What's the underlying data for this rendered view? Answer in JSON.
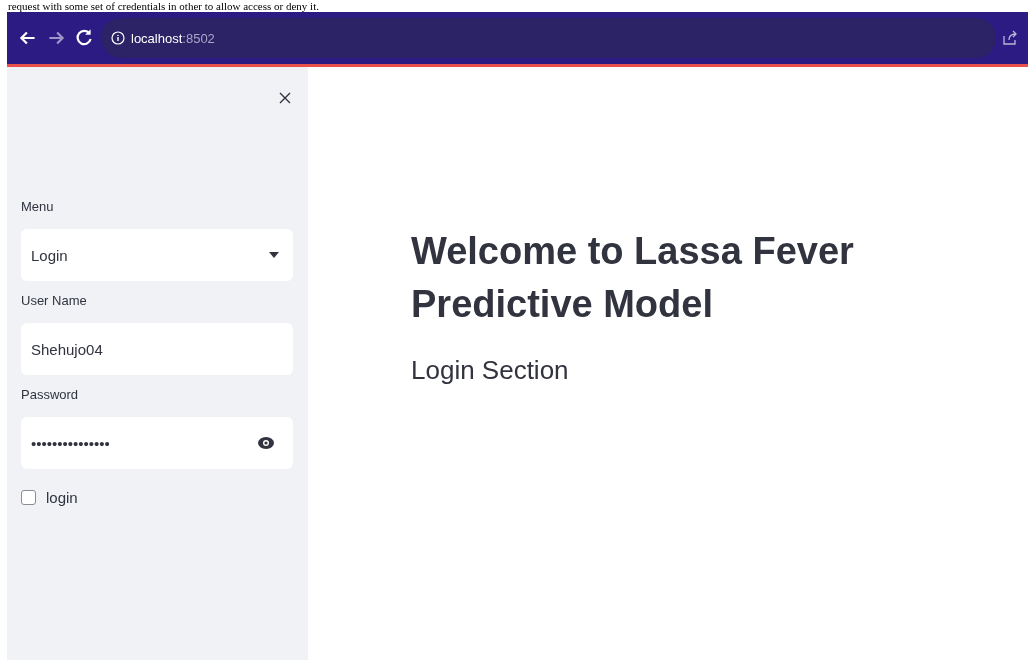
{
  "document_text": "request with some set of credentials in other to allow access or deny it.",
  "browser": {
    "url_host": "localhost",
    "url_port": ":8502"
  },
  "sidebar": {
    "menu": {
      "label": "Menu",
      "value": "Login"
    },
    "user_name": {
      "label": "User Name",
      "value": "Shehujo04"
    },
    "password": {
      "label": "Password",
      "value": "•••••••••••••••"
    },
    "login_checkbox": {
      "label": "login",
      "checked": false
    }
  },
  "main": {
    "title": "Welcome to Lassa Fever Predictive Model",
    "subtitle": "Login Section"
  }
}
